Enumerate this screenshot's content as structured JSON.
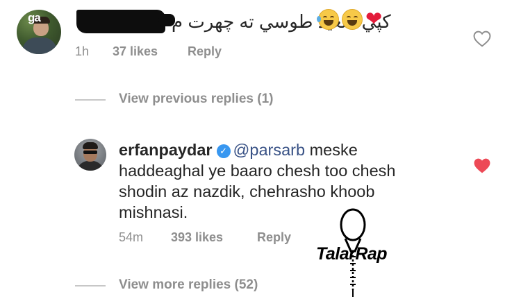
{
  "comment1": {
    "avatar_badge": "ga",
    "text": "کپي سعيد طوسي ته چهرت م",
    "emojis": [
      "tears-of-joy-emoji",
      "laughing-emoji",
      "red-heart-emoji"
    ],
    "time": "1h",
    "likes": "37 likes",
    "reply": "Reply"
  },
  "view_previous": "View previous replies (1)",
  "comment2": {
    "username": "erfanpaydar",
    "verified": true,
    "mention": "@parsarb",
    "text": " meske haddeaghal ye baaro chesh too chesh shodin az nazdik, chehrasho khoob mishnasi.",
    "time": "54m",
    "likes": "393 likes",
    "reply": "Reply",
    "liked": true
  },
  "view_more": "View more replies (52)",
  "watermark": "TalarRap",
  "colors": {
    "meta": "#8e8e8e",
    "heart_liked": "#ed4956",
    "verified": "#3897f0",
    "mention": "#385185"
  }
}
